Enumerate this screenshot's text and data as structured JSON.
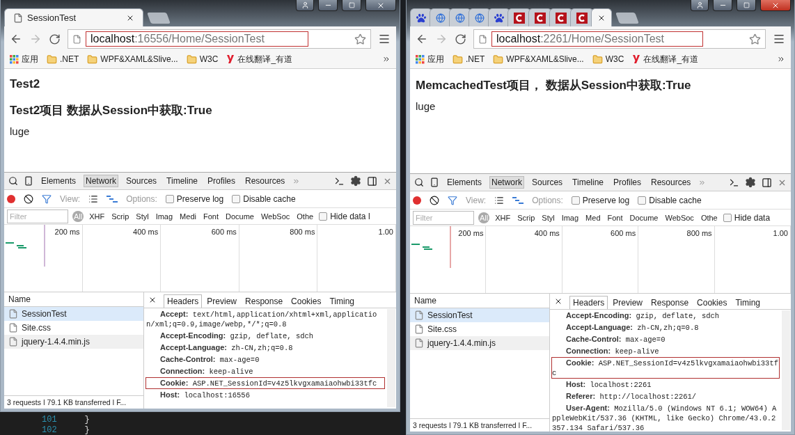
{
  "windows": [
    {
      "tabs": [
        {
          "kind": "page",
          "title": "SessionTest",
          "selected": true
        }
      ],
      "address": {
        "host": "localhost",
        "path": ":16556/Home/SessionTest",
        "highlighted": true
      },
      "bookmarks": [
        {
          "kind": "apps",
          "label": "应用"
        },
        {
          "kind": "folder",
          "label": ".NET"
        },
        {
          "kind": "folder",
          "label": "WPF&XAML&Slive..."
        },
        {
          "kind": "folder",
          "label": "W3C"
        },
        {
          "kind": "youdao",
          "label": "在线翻译_有道"
        }
      ],
      "page": [
        {
          "kind": "title",
          "text": "Test2"
        },
        {
          "kind": "title",
          "text": "Test2项目 数据从Session中获取:True"
        },
        {
          "kind": "body",
          "text": "luge"
        }
      ],
      "devtools": {
        "panels": [
          {
            "label": "Elements",
            "selected": false
          },
          {
            "label": "Network",
            "selected": true
          },
          {
            "label": "Sources",
            "selected": false
          },
          {
            "label": "Timeline",
            "selected": false
          },
          {
            "label": "Profiles",
            "selected": false
          },
          {
            "label": "Resources",
            "selected": false
          }
        ],
        "recording": true,
        "view_label": "View:",
        "options_label": "Options:",
        "options": [
          {
            "label": "Preserve log",
            "checked": false
          },
          {
            "label": "Disable cache",
            "checked": false
          }
        ],
        "filter": {
          "placeholder": "Filter"
        },
        "types": [
          {
            "label": "All",
            "selected": true
          },
          {
            "label": "XHF",
            "selected": false
          },
          {
            "label": "Scrip",
            "selected": false
          },
          {
            "label": "Styl",
            "selected": false
          },
          {
            "label": "Imag",
            "selected": false
          },
          {
            "label": "Medi",
            "selected": false
          },
          {
            "label": "Font",
            "selected": false
          },
          {
            "label": "Docume",
            "selected": false
          },
          {
            "label": "WebSoc",
            "selected": false
          },
          {
            "label": "Othe",
            "selected": false
          }
        ],
        "hide_data": {
          "label": "Hide data l",
          "checked": false
        },
        "ticks": [
          "200 ms",
          "400 ms",
          "600 ms",
          "800 ms",
          "1.00"
        ],
        "requests_heading": "Name",
        "requests": [
          {
            "name": "SessionTest",
            "selected": true
          },
          {
            "name": "Site.css",
            "selected": false
          },
          {
            "name": "jquery-1.4.4.min.js",
            "selected": false
          }
        ],
        "detail_tabs": [
          {
            "label": "Headers",
            "selected": true
          },
          {
            "label": "Preview",
            "selected": false
          },
          {
            "label": "Response",
            "selected": false
          },
          {
            "label": "Cookies",
            "selected": false
          },
          {
            "label": "Timing",
            "selected": false
          }
        ],
        "headers": [
          {
            "name": "Accept:",
            "value": "text/html,application/xhtml+xml,application/xml;q=0.9,image/webp,*/*;q=0.8",
            "highlighted": false
          },
          {
            "name": "Accept-Encoding:",
            "value": "gzip, deflate, sdch",
            "highlighted": false
          },
          {
            "name": "Accept-Language:",
            "value": "zh-CN,zh;q=0.8",
            "highlighted": false
          },
          {
            "name": "Cache-Control:",
            "value": "max-age=0",
            "highlighted": false
          },
          {
            "name": "Connection:",
            "value": "keep-alive",
            "highlighted": false
          },
          {
            "name": "Cookie:",
            "value": "ASP.NET_SessionId=v4z5lkvgxamaiaohwbi33tfc",
            "highlighted": true
          },
          {
            "name": "Host:",
            "value": "localhost:16556",
            "highlighted": false
          }
        ],
        "status": "3 requests ǀ 79.1 KB transferred ǀ F..."
      }
    },
    {
      "tabs": [
        {
          "kind": "paw",
          "selected": false
        },
        {
          "kind": "globe",
          "selected": false
        },
        {
          "kind": "globe",
          "selected": false
        },
        {
          "kind": "globe",
          "selected": false
        },
        {
          "kind": "paw",
          "selected": false
        },
        {
          "kind": "c",
          "selected": false
        },
        {
          "kind": "c",
          "selected": false
        },
        {
          "kind": "c",
          "selected": false
        },
        {
          "kind": "c",
          "selected": false
        },
        {
          "kind": "blank",
          "selected": true
        }
      ],
      "address": {
        "host": "localhost",
        "path": ":2261/Home/SessionTest",
        "highlighted": true
      },
      "bookmarks": [
        {
          "kind": "apps",
          "label": "应用"
        },
        {
          "kind": "folder",
          "label": ".NET"
        },
        {
          "kind": "folder",
          "label": "WPF&XAML&Slive..."
        },
        {
          "kind": "folder",
          "label": "W3C"
        },
        {
          "kind": "youdao",
          "label": "在线翻译_有道"
        }
      ],
      "page": [
        {
          "kind": "title",
          "text": "MemcachedTest项目， 数据从Session中获取:True"
        },
        {
          "kind": "body",
          "text": "luge"
        }
      ],
      "devtools": {
        "panels": [
          {
            "label": "Elements",
            "selected": false
          },
          {
            "label": "Network",
            "selected": true
          },
          {
            "label": "Sources",
            "selected": false
          },
          {
            "label": "Timeline",
            "selected": false
          },
          {
            "label": "Profiles",
            "selected": false
          },
          {
            "label": "Resources",
            "selected": false
          }
        ],
        "recording": true,
        "view_label": "View:",
        "options_label": "Options:",
        "options": [
          {
            "label": "Preserve log",
            "checked": false
          },
          {
            "label": "Disable cache",
            "checked": false
          }
        ],
        "filter": {
          "placeholder": "Filter"
        },
        "types": [
          {
            "label": "All",
            "selected": true
          },
          {
            "label": "XHF",
            "selected": false
          },
          {
            "label": "Scrip",
            "selected": false
          },
          {
            "label": "Styl",
            "selected": false
          },
          {
            "label": "Imag",
            "selected": false
          },
          {
            "label": "Med",
            "selected": false
          },
          {
            "label": "Font",
            "selected": false
          },
          {
            "label": "Docume",
            "selected": false
          },
          {
            "label": "WebSoc",
            "selected": false
          },
          {
            "label": "Othe",
            "selected": false
          }
        ],
        "hide_data": {
          "label": "Hide data",
          "checked": false
        },
        "ticks": [
          "200 ms",
          "400 ms",
          "600 ms",
          "800 ms",
          "1.00"
        ],
        "requests_heading": "Name",
        "requests": [
          {
            "name": "SessionTest",
            "selected": true
          },
          {
            "name": "Site.css",
            "selected": false
          },
          {
            "name": "jquery-1.4.4.min.js",
            "selected": false
          }
        ],
        "detail_tabs": [
          {
            "label": "Headers",
            "selected": true
          },
          {
            "label": "Preview",
            "selected": false
          },
          {
            "label": "Response",
            "selected": false
          },
          {
            "label": "Cookies",
            "selected": false
          },
          {
            "label": "Timing",
            "selected": false
          }
        ],
        "headers": [
          {
            "name": "Accept-Encoding:",
            "value": "gzip, deflate, sdch",
            "highlighted": false
          },
          {
            "name": "Accept-Language:",
            "value": "zh-CN,zh;q=0.8",
            "highlighted": false
          },
          {
            "name": "Cache-Control:",
            "value": "max-age=0",
            "highlighted": false
          },
          {
            "name": "Connection:",
            "value": "keep-alive",
            "highlighted": false
          },
          {
            "name": "Cookie:",
            "value": "ASP.NET_SessionId=v4z5lkvgxamaiaohwbi33tfc",
            "highlighted": true
          },
          {
            "name": "Host:",
            "value": "localhost:2261",
            "highlighted": false
          },
          {
            "name": "Referer:",
            "value": "http://localhost:2261/",
            "highlighted": false
          },
          {
            "name": "User-Agent:",
            "value": "Mozilla/5.0 (Windows NT 6.1; WOW64) AppleWebKit/537.36 (KHTML, like Gecko) Chrome/43.0.2357.134 Safari/537.36",
            "highlighted": false
          }
        ],
        "status": "3 requests ǀ 79.1 KB transferred ǀ F..."
      }
    }
  ],
  "editor_lines": [
    {
      "number": "101",
      "code": "}"
    },
    {
      "number": "102",
      "code": "}"
    }
  ]
}
